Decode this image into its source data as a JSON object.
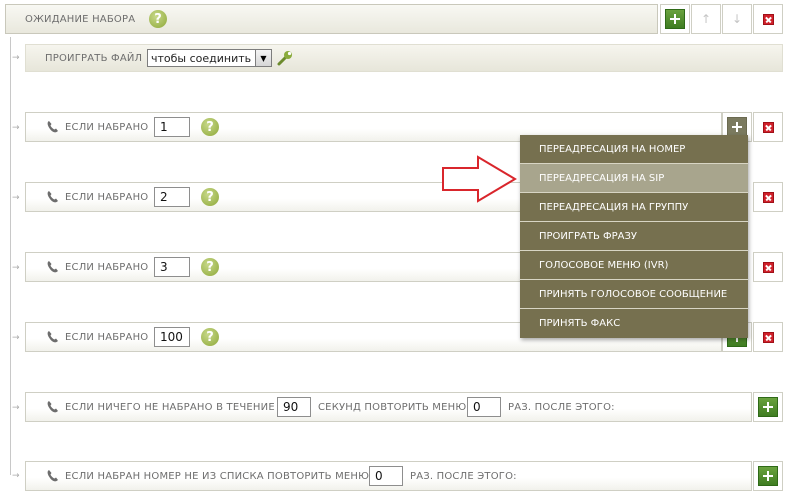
{
  "header": {
    "title": "ОЖИДАНИЕ НАБОРА"
  },
  "play_file": {
    "label": "ПРОИГРАТЬ ФАЙЛ",
    "selected": "чтобы соединить"
  },
  "digit_rows": [
    {
      "label": "ЕСЛИ НАБРАНО",
      "value": "1"
    },
    {
      "label": "ЕСЛИ НАБРАНО",
      "value": "2"
    },
    {
      "label": "ЕСЛИ НАБРАНО",
      "value": "3"
    },
    {
      "label": "ЕСЛИ НАБРАНО",
      "value": "100"
    }
  ],
  "timeout_row": {
    "label": "ЕСЛИ НИЧЕГО НЕ НАБРАНО В ТЕЧЕНИЕ",
    "seconds": "90",
    "middle": "СЕКУНД ПОВТОРИТЬ МЕНЮ",
    "repeat": "0",
    "after": "РАЗ. ПОСЛЕ ЭТОГО:"
  },
  "invalid_row": {
    "label": "ЕСЛИ НАБРАН НОМЕР НЕ ИЗ СПИСКА ПОВТОРИТЬ МЕНЮ",
    "repeat": "0",
    "after": "РАЗ. ПОСЛЕ ЭТОГО:"
  },
  "menu": {
    "items": [
      "ПЕРЕАДРЕСАЦИЯ НА НОМЕР",
      "ПЕРЕАДРЕСАЦИЯ НА SIP",
      "ПЕРЕАДРЕСАЦИЯ НА ГРУППУ",
      "ПРОИГРАТЬ ФРАЗУ",
      "ГОЛОСОВОЕ МЕНЮ (IVR)",
      "ПРИНЯТЬ ГОЛОСОВОЕ СООБЩЕНИЕ",
      "ПРИНЯТЬ ФАКС"
    ],
    "highlighted": "ПЕРЕАДРЕСАЦИЯ НА SIP"
  },
  "icons": {
    "help": "?",
    "phone": "phone-icon",
    "wrench": "wrench-icon"
  },
  "colors": {
    "accent_green": "#4a8a2a",
    "menu_bg": "#76704f",
    "menu_highlight": "#a8a58d",
    "pointer_arrow": "#d9262c"
  }
}
